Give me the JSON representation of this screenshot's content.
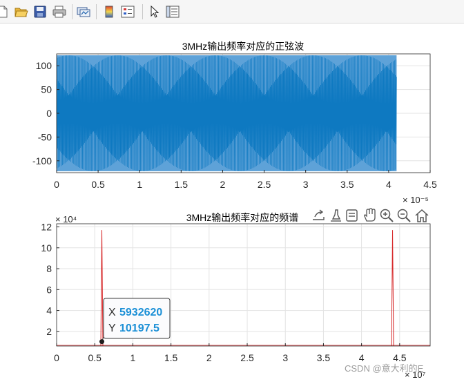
{
  "toolbar": {
    "buttons": [
      {
        "name": "new-figure-icon",
        "icon": "new-file"
      },
      {
        "name": "open-file-icon",
        "icon": "folder"
      },
      {
        "name": "save-figure-icon",
        "icon": "floppy-disk"
      },
      {
        "name": "print-figure-icon",
        "icon": "printer"
      },
      {
        "name": "link-plot-icon",
        "icon": "link-plot"
      },
      {
        "name": "insert-colorbar-icon",
        "icon": "colorbar"
      },
      {
        "name": "insert-legend-icon",
        "icon": "legend"
      },
      {
        "name": "edit-plot-icon",
        "icon": "arrow-cursor"
      },
      {
        "name": "property-inspector-icon",
        "icon": "property-inspector"
      }
    ]
  },
  "axes_toolbar": {
    "buttons": [
      {
        "name": "export-icon",
        "icon": "export"
      },
      {
        "name": "brush-icon",
        "icon": "brush"
      },
      {
        "name": "datatip-icon",
        "icon": "datatip"
      },
      {
        "name": "pan-icon",
        "icon": "hand"
      },
      {
        "name": "zoom-in-icon",
        "icon": "magnifier-plus"
      },
      {
        "name": "zoom-out-icon",
        "icon": "magnifier-minus"
      },
      {
        "name": "restore-view-icon",
        "icon": "home"
      }
    ]
  },
  "chart_data": [
    {
      "type": "line",
      "title": "3MHz输出频率对应的正弦波",
      "xlabel": "",
      "ylabel": "",
      "xlim": [
        0,
        4.5
      ],
      "x_exponent_label": "× 10⁻⁵",
      "ylim": [
        -125,
        125
      ],
      "xticks": [
        "0",
        "0.5",
        "1",
        "1.5",
        "2",
        "2.5",
        "3",
        "3.5",
        "4",
        "4.5"
      ],
      "yticks": [
        "100",
        "50",
        "0",
        "-50",
        "-100"
      ],
      "grid": true,
      "series": [
        {
          "color": "#0072bd",
          "x_range": [
            0,
            4.0955
          ],
          "amplitude": 122,
          "signal": "dense sinusoid, visually filled envelope"
        }
      ]
    },
    {
      "type": "line",
      "title": "3MHz输出频率对应的频谱",
      "xlabel": "",
      "ylabel": "",
      "xlim": [
        0,
        4.9
      ],
      "ylim": [
        0.6,
        12.3
      ],
      "y_exponent_label": "× 10⁴",
      "x_exponent_label": "× 10⁷",
      "xticks": [
        "0",
        "0.5",
        "1",
        "1.5",
        "2",
        "2.5",
        "3",
        "3.5",
        "4",
        "4.5"
      ],
      "yticks": [
        "12",
        "10",
        "8",
        "6",
        "4",
        "2"
      ],
      "grid": true,
      "series": [
        {
          "color": "#d62728",
          "peaks": [
            {
              "x": 0.593262,
              "y": 11.7
            },
            {
              "x": 4.4067,
              "y": 11.7
            }
          ]
        }
      ],
      "datatip": {
        "x_label": "X",
        "x_value": "5932620",
        "y_label": "Y",
        "y_value": "10197.5",
        "x": 0.593262,
        "y": 1.01975
      }
    }
  ],
  "watermark": "CSDN @意大利的E"
}
